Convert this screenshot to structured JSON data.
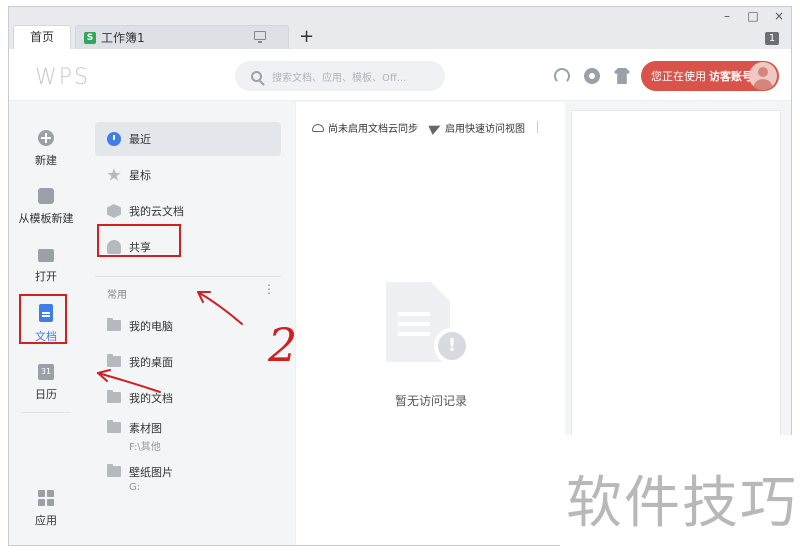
{
  "tabs": {
    "home_label": "首页",
    "doc_label": "工作簿1",
    "doc_icon_letter": "S",
    "add_label": "+",
    "count_badge": "1"
  },
  "window_controls": {
    "minimize": "–",
    "maximize": "□",
    "close": "×"
  },
  "header": {
    "logo_text": "WPS",
    "search_placeholder": "搜索文档、应用、模板、Off...",
    "account_prefix": "您正在使用",
    "account_name": "访客账号"
  },
  "rail": {
    "items": [
      {
        "label": "新建",
        "icon": "plus-circle-icon"
      },
      {
        "label": "从模板新建",
        "icon": "template-icon"
      },
      {
        "label": "打开",
        "icon": "folder-open-icon"
      },
      {
        "label": "文档",
        "icon": "document-icon"
      },
      {
        "label": "日历",
        "icon": "calendar-icon",
        "icon_text": "31"
      },
      {
        "label": "应用",
        "icon": "apps-grid-icon"
      }
    ]
  },
  "nav": {
    "items": [
      {
        "label": "最近",
        "icon": "clock-icon"
      },
      {
        "label": "星标",
        "icon": "star-icon"
      },
      {
        "label": "我的云文档",
        "icon": "cloud-box-icon"
      },
      {
        "label": "共享",
        "icon": "people-icon"
      }
    ],
    "section_title": "常用",
    "more_label": "⋮",
    "folders": [
      {
        "label": "我的电脑",
        "sub": ""
      },
      {
        "label": "我的桌面",
        "sub": ""
      },
      {
        "label": "我的文档",
        "sub": ""
      },
      {
        "label": "素材图",
        "sub": "F:\\其他"
      },
      {
        "label": "壁纸图片",
        "sub": "G:"
      }
    ]
  },
  "main": {
    "toolbar": {
      "cloud_sync": "尚未启用文档云同步",
      "quick_view": "启用快速访问视图"
    },
    "empty_text": "暂无访问记录"
  },
  "annotations": {
    "number_label": "2"
  },
  "watermark": "软件技巧",
  "colors": {
    "accent": "#3f7ee8",
    "account_bg": "#d9534a",
    "annotation": "#d02020"
  }
}
